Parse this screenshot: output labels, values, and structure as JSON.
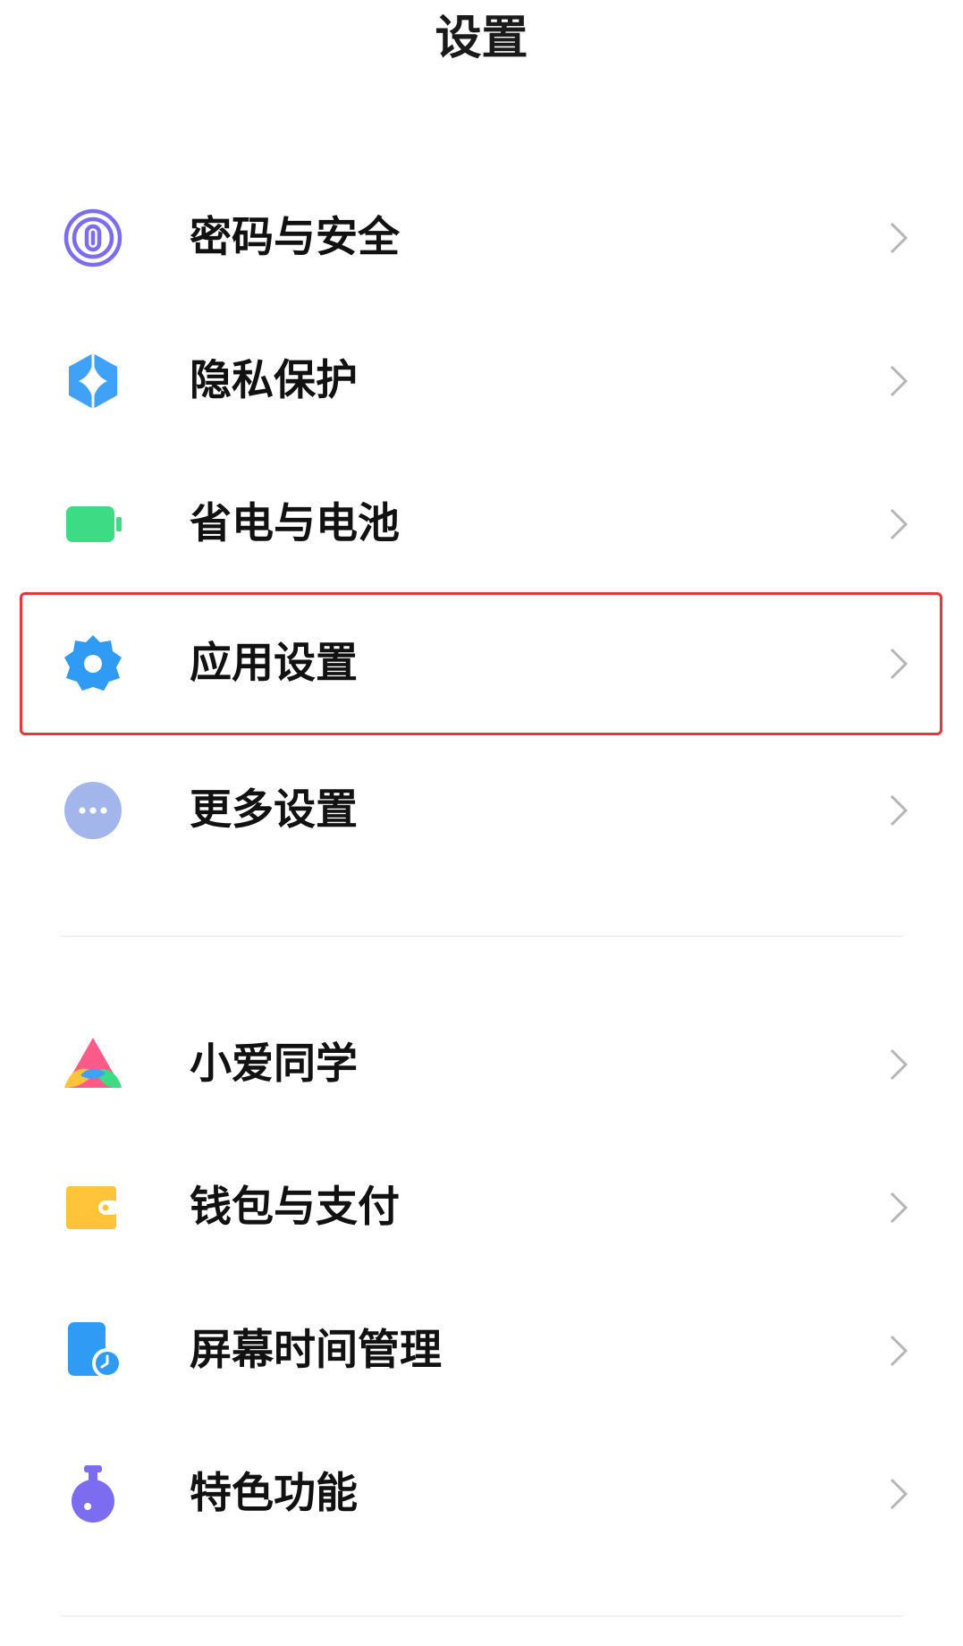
{
  "header": {
    "title": "设置"
  },
  "groups": [
    {
      "items": [
        {
          "label": "密码与安全",
          "icon": "fingerprint-icon",
          "color": "#7b6cf0"
        },
        {
          "label": "隐私保护",
          "icon": "privacy-shield-icon",
          "color": "#3fa2f7"
        },
        {
          "label": "省电与电池",
          "icon": "battery-icon",
          "color": "#3ddc84"
        },
        {
          "label": "应用设置",
          "icon": "gear-icon",
          "color": "#2f9bf5"
        },
        {
          "label": "更多设置",
          "icon": "more-dots-icon",
          "color": "#a3b6ec"
        }
      ]
    },
    {
      "items": [
        {
          "label": "小爱同学",
          "icon": "xiaoai-icon",
          "color": "#ff5a8a"
        },
        {
          "label": "钱包与支付",
          "icon": "wallet-icon",
          "color": "#ffc43a"
        },
        {
          "label": "屏幕时间管理",
          "icon": "screen-time-icon",
          "color": "#2f9bf5"
        },
        {
          "label": "特色功能",
          "icon": "feature-flask-icon",
          "color": "#7b6cf0"
        }
      ]
    }
  ],
  "highlight": {
    "item": "应用设置",
    "color": "#e53935"
  }
}
